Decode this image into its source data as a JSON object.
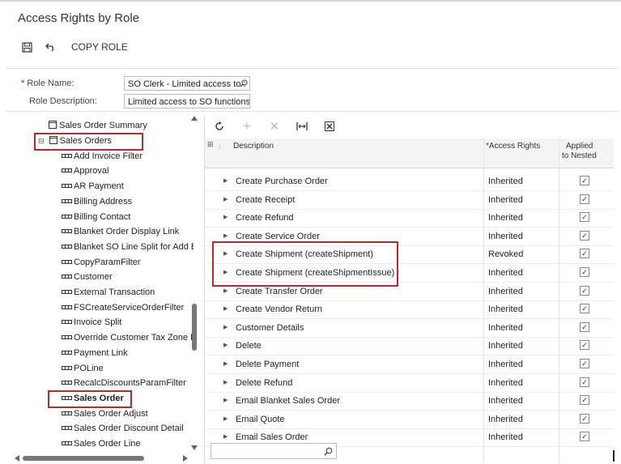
{
  "page": {
    "title": "Access Rights by Role"
  },
  "toolbar": {
    "copy_role": "COPY ROLE"
  },
  "form": {
    "role_name_label": "Role Name:",
    "role_name_value": "SO Clerk - Limited access to :",
    "role_desc_label": "Role Description:",
    "role_desc_value": "Limited access to SO functions"
  },
  "tree": {
    "items": [
      {
        "label": "Sales Order Summary",
        "kind": "screen"
      },
      {
        "label": "Sales Orders",
        "kind": "screen"
      },
      {
        "label": "Add Invoice Filter",
        "kind": "node"
      },
      {
        "label": "Approval",
        "kind": "node"
      },
      {
        "label": "AR Payment",
        "kind": "node"
      },
      {
        "label": "Billing Address",
        "kind": "node"
      },
      {
        "label": "Billing Contact",
        "kind": "node"
      },
      {
        "label": "Blanket Order Display Link",
        "kind": "node"
      },
      {
        "label": "Blanket SO Line Split for Add Bl",
        "kind": "node"
      },
      {
        "label": "CopyParamFilter",
        "kind": "node"
      },
      {
        "label": "Customer",
        "kind": "node"
      },
      {
        "label": "External Transaction",
        "kind": "node"
      },
      {
        "label": "FSCreateServiceOrderFilter",
        "kind": "node"
      },
      {
        "label": "Invoice Split",
        "kind": "node"
      },
      {
        "label": "Override Customer Tax Zone Fil",
        "kind": "node"
      },
      {
        "label": "Payment Link",
        "kind": "node"
      },
      {
        "label": "POLine",
        "kind": "node"
      },
      {
        "label": "RecalcDiscountsParamFilter",
        "kind": "node"
      },
      {
        "label": "Sales Order",
        "kind": "node"
      },
      {
        "label": "Sales Order Adjust",
        "kind": "node"
      },
      {
        "label": "Sales Order Discount Detail",
        "kind": "node"
      },
      {
        "label": "Sales Order Line",
        "kind": "node"
      }
    ]
  },
  "grid": {
    "headers": {
      "description": "Description",
      "access_rights": "Access Rights",
      "applied_1": "Applied",
      "applied_2": "to Nested"
    },
    "rows": [
      {
        "desc": "Create Purchase Order",
        "rights": "Inherited"
      },
      {
        "desc": "Create Receipt",
        "rights": "Inherited"
      },
      {
        "desc": "Create Refund",
        "rights": "Inherited"
      },
      {
        "desc": "Create Service Order",
        "rights": "Inherited"
      },
      {
        "desc": "Create Shipment (createShipment)",
        "rights": "Revoked"
      },
      {
        "desc": "Create Shipment (createShipmentIssue)",
        "rights": "Inherited"
      },
      {
        "desc": "Create Transfer Order",
        "rights": "Inherited"
      },
      {
        "desc": "Create Vendor Return",
        "rights": "Inherited"
      },
      {
        "desc": "Customer Details",
        "rights": "Inherited"
      },
      {
        "desc": "Delete",
        "rights": "Inherited"
      },
      {
        "desc": "Delete Payment",
        "rights": "Inherited"
      },
      {
        "desc": "Delete Refund",
        "rights": "Inherited"
      },
      {
        "desc": "Email Blanket Sales Order",
        "rights": "Inherited"
      },
      {
        "desc": "Email Quote",
        "rights": "Inherited"
      },
      {
        "desc": "Email Sales Order",
        "rights": "Inherited"
      }
    ]
  },
  "colors": {
    "highlight": "#c0272d",
    "header_bg": "#f4f4f4"
  }
}
